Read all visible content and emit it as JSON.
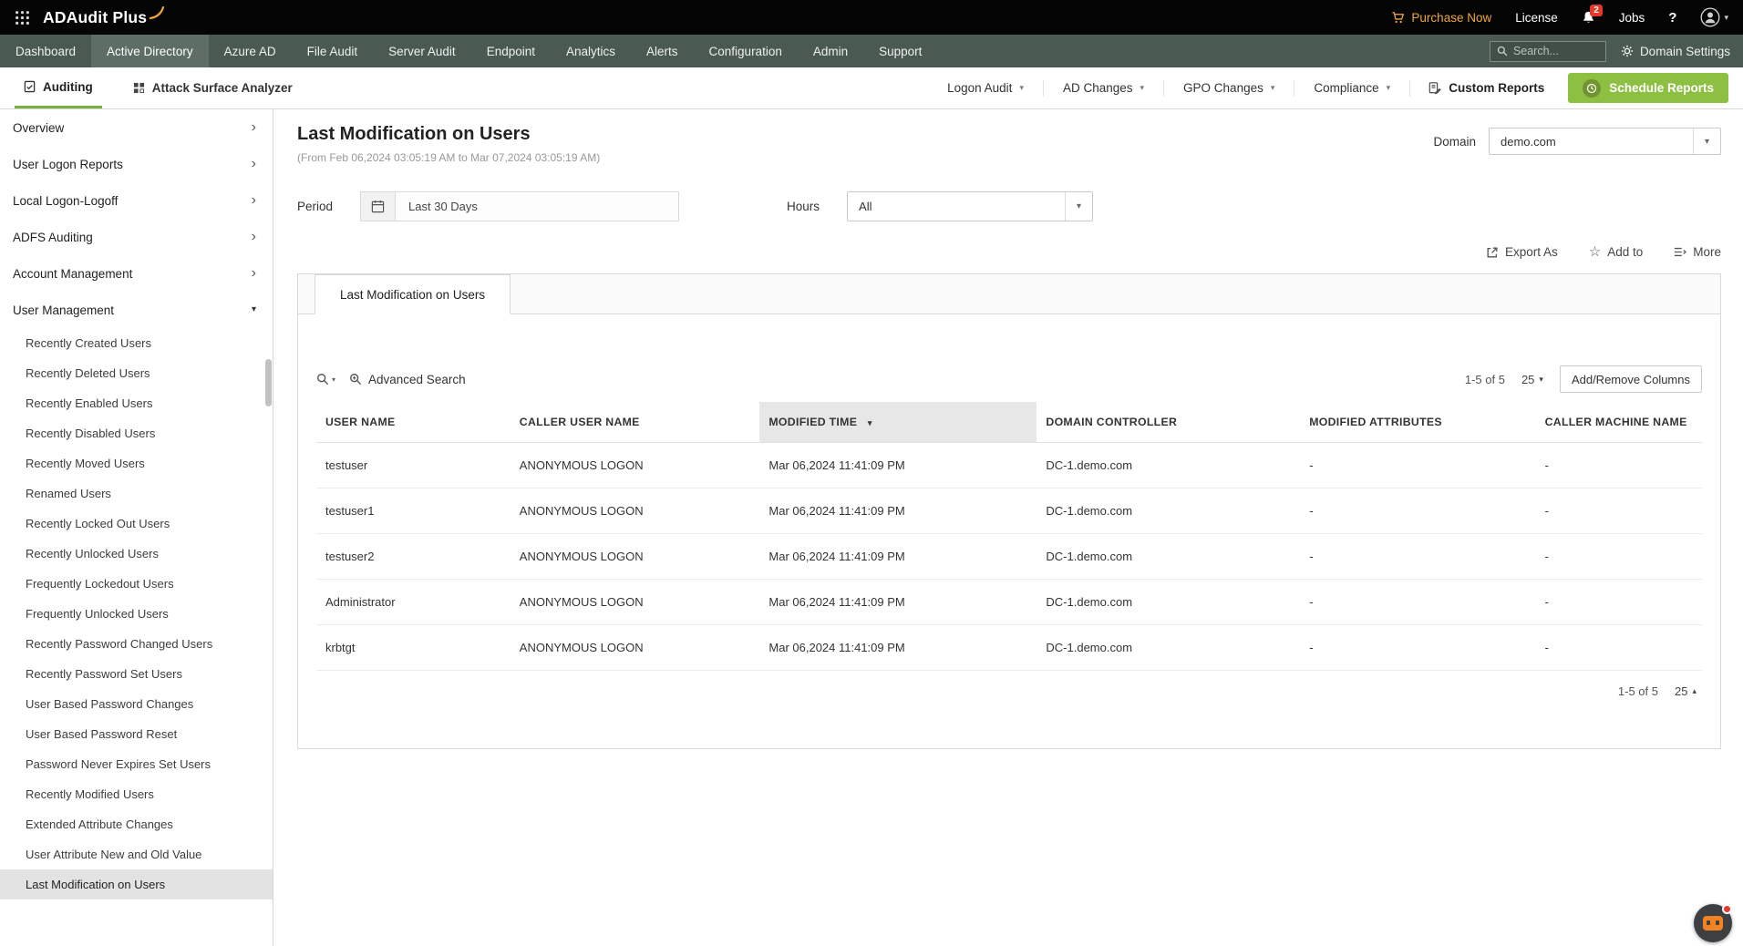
{
  "colors": {
    "topbar_bg": "#050505",
    "nav_bg": "#4a5952",
    "nav_active_bg": "#5e6e66",
    "accent_green": "#8dbf42",
    "underline_green": "#76b043",
    "accent_orange": "#efa53d",
    "badge_red": "#e5382d",
    "selected_item_bg": "#e3e3e3",
    "sorted_column_bg": "#e7e7e7"
  },
  "topbar": {
    "brand": "ADAudit Plus",
    "purchase_now": "Purchase Now",
    "license": "License",
    "notifications_count": "2",
    "jobs": "Jobs",
    "help": "?"
  },
  "nav": {
    "items": [
      {
        "label": "Dashboard"
      },
      {
        "label": "Active Directory"
      },
      {
        "label": "Azure AD"
      },
      {
        "label": "File Audit"
      },
      {
        "label": "Server Audit"
      },
      {
        "label": "Endpoint"
      },
      {
        "label": "Analytics"
      },
      {
        "label": "Alerts"
      },
      {
        "label": "Configuration"
      },
      {
        "label": "Admin"
      },
      {
        "label": "Support"
      }
    ],
    "search_placeholder": "Search...",
    "domain_settings": "Domain Settings"
  },
  "subnav": {
    "auditing": "Auditing",
    "attack_surface_analyzer": "Attack Surface Analyzer",
    "logon_audit": "Logon Audit",
    "ad_changes": "AD Changes",
    "gpo_changes": "GPO Changes",
    "compliance": "Compliance",
    "custom_reports": "Custom Reports",
    "schedule_reports": "Schedule Reports"
  },
  "sidebar": {
    "groups": [
      {
        "label": "Overview"
      },
      {
        "label": "User Logon Reports"
      },
      {
        "label": "Local Logon-Logoff"
      },
      {
        "label": "ADFS Auditing"
      },
      {
        "label": "Account Management"
      },
      {
        "label": "User Management"
      }
    ],
    "user_management_items": [
      {
        "label": "Recently Created Users"
      },
      {
        "label": "Recently Deleted Users"
      },
      {
        "label": "Recently Enabled Users"
      },
      {
        "label": "Recently Disabled Users"
      },
      {
        "label": "Recently Moved Users"
      },
      {
        "label": "Renamed Users"
      },
      {
        "label": "Recently Locked Out Users"
      },
      {
        "label": "Recently Unlocked Users"
      },
      {
        "label": "Frequently Lockedout Users"
      },
      {
        "label": "Frequently Unlocked Users"
      },
      {
        "label": "Recently Password Changed Users"
      },
      {
        "label": "Recently Password Set Users"
      },
      {
        "label": "User Based Password Changes"
      },
      {
        "label": "User Based Password Reset"
      },
      {
        "label": "Password Never Expires Set Users"
      },
      {
        "label": "Recently Modified Users"
      },
      {
        "label": "Extended Attribute Changes"
      },
      {
        "label": "User Attribute New and Old Value"
      },
      {
        "label": "Last Modification on Users"
      }
    ]
  },
  "main": {
    "title": "Last Modification on Users",
    "subtitle": "(From Feb 06,2024 03:05:19 AM to Mar 07,2024 03:05:19 AM)",
    "domain_label": "Domain",
    "domain_value": "demo.com",
    "period_label": "Period",
    "period_value": "Last 30 Days",
    "hours_label": "Hours",
    "hours_value": "All",
    "export_as": "Export As",
    "add_to": "Add to",
    "more": "More",
    "report_tab": "Last Modification on Users",
    "table": {
      "advanced_search": "Advanced Search",
      "range": "1-5 of 5",
      "page_size": "25",
      "add_remove_columns": "Add/Remove Columns",
      "columns": [
        "USER NAME",
        "CALLER USER NAME",
        "MODIFIED TIME",
        "DOMAIN CONTROLLER",
        "MODIFIED ATTRIBUTES",
        "CALLER MACHINE NAME"
      ],
      "rows": [
        [
          "testuser",
          "ANONYMOUS LOGON",
          "Mar 06,2024 11:41:09 PM",
          "DC-1.demo.com",
          "-",
          "-"
        ],
        [
          "testuser1",
          "ANONYMOUS LOGON",
          "Mar 06,2024 11:41:09 PM",
          "DC-1.demo.com",
          "-",
          "-"
        ],
        [
          "testuser2",
          "ANONYMOUS LOGON",
          "Mar 06,2024 11:41:09 PM",
          "DC-1.demo.com",
          "-",
          "-"
        ],
        [
          "Administrator",
          "ANONYMOUS LOGON",
          "Mar 06,2024 11:41:09 PM",
          "DC-1.demo.com",
          "-",
          "-"
        ],
        [
          "krbtgt",
          "ANONYMOUS LOGON",
          "Mar 06,2024 11:41:09 PM",
          "DC-1.demo.com",
          "-",
          "-"
        ]
      ],
      "footer_range": "1-5 of 5",
      "footer_page_size": "25"
    }
  }
}
